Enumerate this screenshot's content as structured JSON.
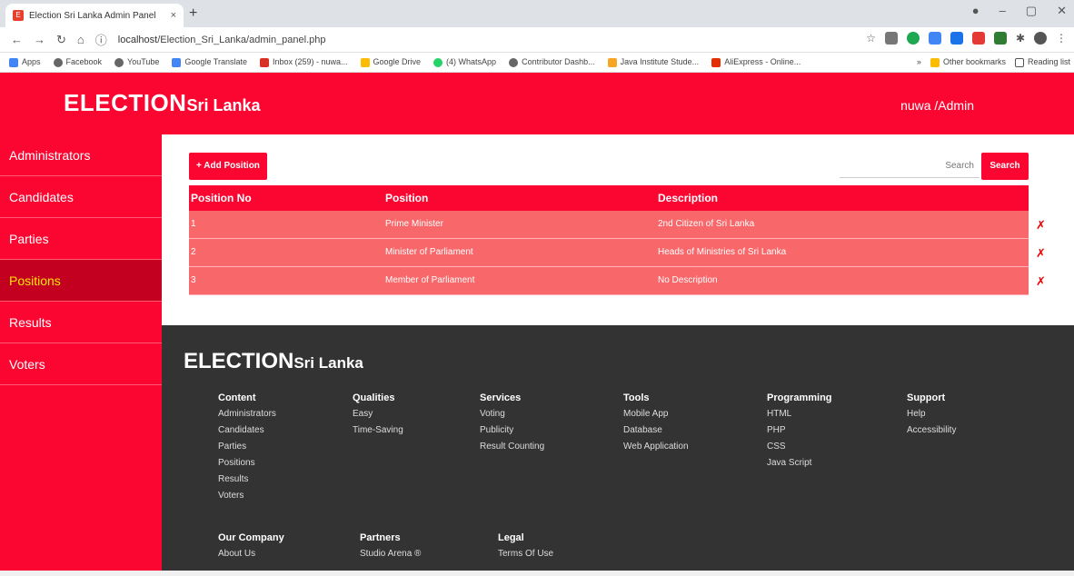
{
  "browser": {
    "tab_title": "Election Sri Lanka Admin Panel",
    "tab_close": "×",
    "new_tab": "+",
    "url_host": "localhost",
    "url_path": "/Election_Sri_Lanka/admin_panel.php",
    "bookmarks": [
      "Apps",
      "Facebook",
      "YouTube",
      "Google Translate",
      "Inbox (259) - nuwa...",
      "Google Drive",
      "(4) WhatsApp",
      "Contributor Dashb...",
      "Java Institute Stude...",
      "AliExpress - Online..."
    ],
    "bookmarks_more": "»",
    "other_bookmarks": "Other bookmarks",
    "reading_list": "Reading list"
  },
  "header": {
    "brand_main": "ELECTION",
    "brand_sub": "Sri Lanka",
    "user": "nuwa /Admin"
  },
  "sidebar": {
    "items": [
      "Administrators",
      "Candidates",
      "Parties",
      "Positions",
      "Results",
      "Voters"
    ],
    "active": "Positions"
  },
  "toolbar": {
    "add_label": "+ Add Position",
    "search_placeholder": "Search",
    "search_button": "Search"
  },
  "table": {
    "headers": [
      "Position No",
      "Position",
      "Description"
    ],
    "rows": [
      [
        "1",
        "Prime Minister",
        "2nd Citizen of Sri Lanka"
      ],
      [
        "2",
        "Minister of Parliament",
        "Heads of Ministries of Sri Lanka"
      ],
      [
        "3",
        "Member of Parliament",
        "No Description"
      ]
    ],
    "delete_glyph": "✗"
  },
  "footer": {
    "brand_main": "ELECTION",
    "brand_sub": "Sri Lanka",
    "columns": [
      {
        "title": "Content",
        "items": [
          "Administrators",
          "Candidates",
          "Parties",
          "Positions",
          "Results",
          "Voters"
        ]
      },
      {
        "title": "Qualities",
        "items": [
          "Easy",
          "Time-Saving"
        ]
      },
      {
        "title": "Services",
        "items": [
          "Voting",
          "Publicity",
          "Result Counting"
        ]
      },
      {
        "title": "Tools",
        "items": [
          "Mobile App",
          "Database",
          "Web Application"
        ]
      },
      {
        "title": "Programming",
        "items": [
          "HTML",
          "PHP",
          "CSS",
          "Java Script"
        ]
      },
      {
        "title": "Support",
        "items": [
          "Help",
          "Accessibility"
        ]
      }
    ],
    "bottom_columns": [
      {
        "title": "Our Company",
        "items": [
          "About Us"
        ]
      },
      {
        "title": "Partners",
        "items": [
          "Studio Arena ®"
        ]
      },
      {
        "title": "Legal",
        "items": [
          "Terms Of Use"
        ]
      }
    ]
  },
  "colors": {
    "brand_red": "#fa0631",
    "active_red": "#c40020",
    "row_red": "#f8676a",
    "footer_bg": "#333333"
  }
}
